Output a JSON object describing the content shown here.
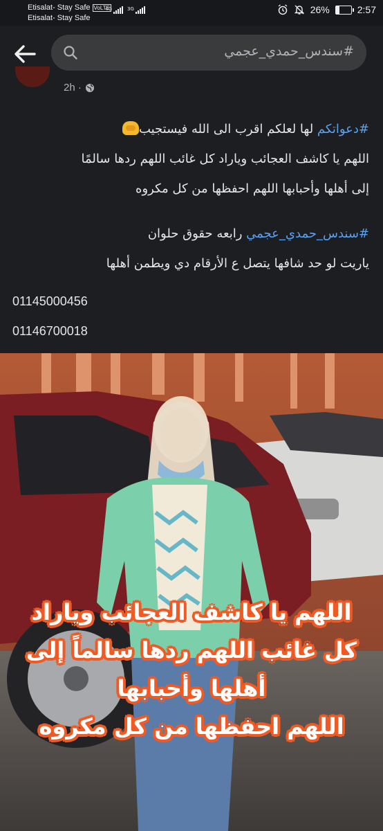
{
  "status_bar": {
    "carrier_1": "Etisalat- Stay Safe",
    "volte": "VoLTE",
    "carrier_2": "Etisalat- Stay Safe",
    "net_1": "4G",
    "net_2": "3G",
    "battery_percent": "26%",
    "battery_level": 0.26,
    "time": "2:57"
  },
  "search": {
    "query": "#سندس_حمدي_عجمي"
  },
  "post": {
    "time": "2h ·",
    "line1_hashtag": "#دعواتكم",
    "line1_text": " لها لعلكم اقرب الى الله فيستجيب",
    "line2": "اللهم يا كاشف العجائب وياراد كل غائب اللهم ردها سالمًا",
    "line3": "إلى أهلها وأحبابها اللهم احفظها من كل مكروه",
    "line4_hashtag": "#سندس_حمدي_عجمي",
    "line4_text": " رابعه حقوق حلوان",
    "line5": "ياريت لو حد شافها يتصل ع الأرقام دي ويطمن أهلها",
    "phone_1": "01145000456",
    "phone_2": "01146700018"
  },
  "image": {
    "caption_1": "اللهم يا كاشف العجائب وياراد",
    "caption_2": "كل غائب اللهم ردها سالماً إلى",
    "caption_3": "أهلها وأحبابها",
    "caption_4": "اللهم احفظها من كل مكروه"
  },
  "colors": {
    "hashtag": "#5aa1f2",
    "background": "#1c1e22",
    "caption_outline": "#f05a24"
  }
}
